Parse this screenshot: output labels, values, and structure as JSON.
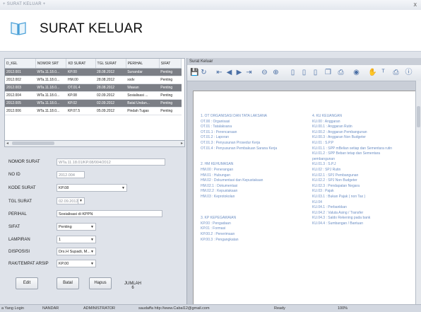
{
  "window": {
    "title": "+ SURAT KELUAR +",
    "close": "x"
  },
  "header": {
    "title": "SURAT KELUAR"
  },
  "grid": {
    "columns": [
      "D_KEL",
      "NOMOR SRT",
      "KD SURAT",
      "TGL SURAT",
      "PERIHAL",
      "SIFAT"
    ],
    "rows": [
      [
        "2012.001",
        "WTa.11.18.0...",
        "KP.00",
        "28.08.2012",
        "Sunandar",
        "Penting"
      ],
      [
        "2012.002",
        "WTa.11.18.0...",
        "HM.00",
        "28.08.2012",
        "xxdv",
        "Penting"
      ],
      [
        "2012.003",
        "WTa.11.18.0...",
        "OT.01.4",
        "28.08.2012",
        "Wawan",
        "Penting"
      ],
      [
        "2012.004",
        "WTa.11.18.0...",
        "KP.08",
        "02.09.2012",
        "Sosialisasi ...",
        "Penting"
      ],
      [
        "2012.005",
        "WTa.11.18.0...",
        "KP.02",
        "02.09.2012",
        "Batal Undan...",
        "Penting"
      ],
      [
        "2012.006",
        "WTa.11.18.0...",
        "KP.07.5",
        "05.09.2012",
        "Pindah Tugas",
        "Penting"
      ]
    ]
  },
  "form": {
    "nomor_surat": {
      "label": "NOMOR SURAT",
      "value": "WTa.11.18.01/KP.08/004/2012"
    },
    "no_id": {
      "label": "NO ID",
      "value": "2012.004"
    },
    "kode_surat": {
      "label": "KODE SURAT",
      "value": "KP.08"
    },
    "tgl_surat": {
      "label": "TGL SURAT",
      "value": "02.09.2012"
    },
    "perihal": {
      "label": "PERIHAL",
      "value": "Sosialisasi di KPPN"
    },
    "sifat": {
      "label": "SIFAT",
      "value": "Penting"
    },
    "lampiran": {
      "label": "LAMPIRAN",
      "value": "1"
    },
    "disposisi": {
      "label": "DISPOSISI",
      "value": "Drs.H Supadi, M..."
    },
    "rak": {
      "label": "RAK/TEMPAT ARSIP",
      "value": "KP.00"
    }
  },
  "buttons": {
    "edit": "Edit",
    "batal": "Batal",
    "hapus": "Hapus"
  },
  "jumlah": {
    "label": "JUMLAH",
    "value": "6"
  },
  "status": {
    "login": "a Yang Login",
    "user": "NANDAR",
    "role": "ADMINISTRATOR",
    "contact": "saudaffa http://www.Cabal12@gmail.com",
    "ready": "Ready",
    "zoom": "100%"
  },
  "viewer": {
    "title": "Surat Keluar",
    "left_column": [
      "1.  OT     ORGANISASI DAN TATA LAKSANA",
      "     OT.00 : Organisasi",
      "     OT.01 : Tatalaksana",
      "     OT.01.1 : Perencanaan",
      "     OT.01.2 : Laporan",
      "     OT.01.3 : Penyusunan Prosedur Kerja",
      "     OT.01.4 : Penyusunan Pembakuan Sarana Kerja",
      "",
      "",
      "2.  HM     KEHUMASAN",
      "     HM.00 : Penerangan",
      "     HM.01 : Hubungan",
      "     HM.02 : Dokumentasi dan Kepustakaan",
      "     HM.02.1 : Dokumentasi",
      "     HM.02.2 : Kepustakaan",
      "     HM.03 : Keprotokolan",
      "",
      "",
      "",
      "3.  KP     KEPEGAWAIAN",
      "     KP.00 : Pengadaan",
      "     KP.01 : Formasi",
      "     KP.00.2 : Penerimaan",
      "     KP.00.3 : Pengangkatan"
    ],
    "right_column": [
      "4.  KU     KEUANGAN",
      "     KU.00 : Anggaran",
      "     KU.00.1 : Anggaran Rutin",
      "     KU.00.2 : Anggaran Pembangunan",
      "     KU.00.3 : Anggaran Non Budgeter",
      "     KU.01 : S.P.P",
      "     KU.01.1 : SPP mBelian setiap dan Sementara rutin",
      "     KU.01.2 : SPP Beban tetap dan Sementara",
      "                   pembangunan",
      "     KU.01.3 : S.P.J",
      "     KU.02 : SPJ Rutin",
      "     KU.02.1 : SPJ Pembangunan",
      "     KU.02.2 : SPJ Non Budgeter",
      "     KU.02.3 : Pendapatan Negara",
      "     KU.03 : Pajak",
      "     KU.03.1 : Bukan Pajak ( non Tax )",
      "     KU.04",
      "     KU.04.1 : Perbankkan",
      "     KU.04.2 : Valuta Asing / Transfer",
      "     KU.04.3 : Saldo Rekening pada bank",
      "     KU.04.4 : Sumbangan / Bantuan"
    ]
  }
}
